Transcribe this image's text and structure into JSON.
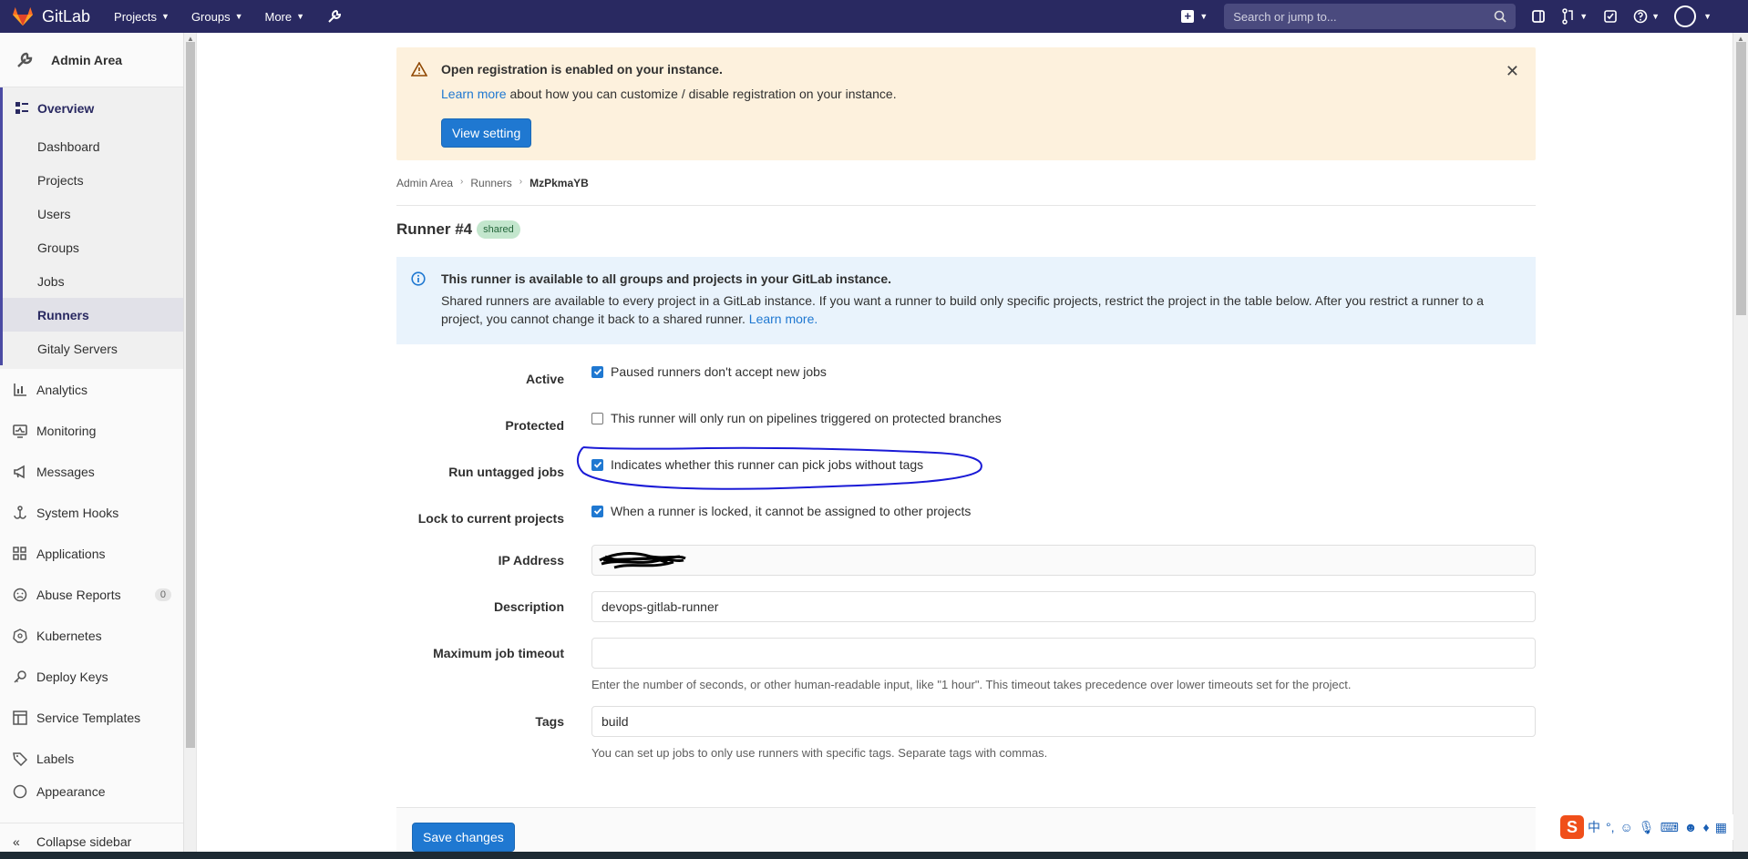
{
  "topnav": {
    "brand": "GitLab",
    "links": [
      {
        "label": "Projects"
      },
      {
        "label": "Groups"
      },
      {
        "label": "More"
      }
    ],
    "search_placeholder": "Search or jump to..."
  },
  "sidebar": {
    "header": "Admin Area",
    "overview": {
      "label": "Overview",
      "items": [
        "Dashboard",
        "Projects",
        "Users",
        "Groups",
        "Jobs",
        "Runners",
        "Gitaly Servers"
      ],
      "active": "Runners"
    },
    "items": [
      {
        "label": "Analytics",
        "icon": "chart-icon"
      },
      {
        "label": "Monitoring",
        "icon": "monitor-icon"
      },
      {
        "label": "Messages",
        "icon": "megaphone-icon"
      },
      {
        "label": "System Hooks",
        "icon": "hook-icon"
      },
      {
        "label": "Applications",
        "icon": "grid-icon"
      },
      {
        "label": "Abuse Reports",
        "icon": "frown-icon",
        "count": "0"
      },
      {
        "label": "Kubernetes",
        "icon": "kubernetes-icon"
      },
      {
        "label": "Deploy Keys",
        "icon": "key-icon"
      },
      {
        "label": "Service Templates",
        "icon": "template-icon"
      },
      {
        "label": "Labels",
        "icon": "label-icon"
      },
      {
        "label": "Appearance",
        "icon": "appearance-icon"
      }
    ],
    "collapse": "Collapse sidebar"
  },
  "alert_warning": {
    "title": "Open registration is enabled on your instance.",
    "link": "Learn more",
    "body": " about how you can customize / disable registration on your instance.",
    "button": "View setting"
  },
  "breadcrumb": [
    "Admin Area",
    "Runners",
    "MzPkmaYB"
  ],
  "runner": {
    "title": "Runner #4",
    "badge": "shared"
  },
  "alert_info": {
    "title": "This runner is available to all groups and projects in your GitLab instance.",
    "body": "Shared runners are available to every project in a GitLab instance. If you want a runner to build only specific projects, restrict the project in the table below. After you restrict a runner to a project, you cannot change it back to a shared runner. ",
    "link": "Learn more."
  },
  "form": {
    "active": {
      "label": "Active",
      "text": "Paused runners don't accept new jobs",
      "checked": true
    },
    "protected": {
      "label": "Protected",
      "text": "This runner will only run on pipelines triggered on protected branches",
      "checked": false
    },
    "untagged": {
      "label": "Run untagged jobs",
      "text": "Indicates whether this runner can pick jobs without tags",
      "checked": true
    },
    "locked": {
      "label": "Lock to current projects",
      "text": "When a runner is locked, it cannot be assigned to other projects",
      "checked": true
    },
    "ip": {
      "label": "IP Address",
      "value": ""
    },
    "description": {
      "label": "Description",
      "value": "devops-gitlab-runner"
    },
    "timeout": {
      "label": "Maximum job timeout",
      "value": "",
      "help": "Enter the number of seconds, or other human-readable input, like \"1 hour\". This timeout takes precedence over lower timeouts set for the project."
    },
    "tags": {
      "label": "Tags",
      "value": "build",
      "help": "You can set up jobs to only use runners with specific tags. Separate tags with commas."
    },
    "save": "Save changes"
  },
  "ime": {
    "glyphs": [
      "中",
      "°,"
    ]
  },
  "colors": {
    "nav": "#292961",
    "primary": "#1f78d1",
    "warning_bg": "#fdf1dd",
    "info_bg": "#e9f3fc",
    "annotation": "#1a1ad6"
  }
}
